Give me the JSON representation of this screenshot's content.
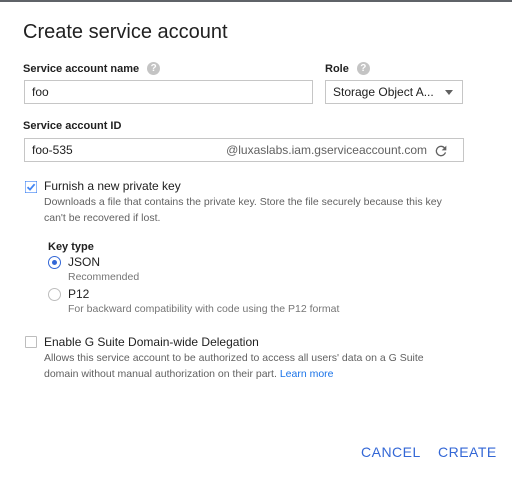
{
  "dialog": {
    "title": "Create service account"
  },
  "fields": {
    "name_label": "Service account name",
    "name_value": "foo",
    "role_label": "Role",
    "role_value": "Storage Object A...",
    "id_label": "Service account ID",
    "id_value": "foo-535",
    "id_suffix": "@luxaslabs.iam.gserviceaccount.com"
  },
  "private_key": {
    "checked": true,
    "label": "Furnish a new private key",
    "description_line1": "Downloads a file that contains the private key. Store the file securely because this key",
    "description_line2": "can't be recovered if lost.",
    "key_type_label": "Key type",
    "options": [
      {
        "label": "JSON",
        "sub": "Recommended",
        "selected": true
      },
      {
        "label": "P12",
        "sub": "For backward compatibility with code using the P12 format",
        "selected": false
      }
    ]
  },
  "delegation": {
    "checked": false,
    "label": "Enable G Suite Domain-wide Delegation",
    "description_line1": "Allows this service account to be authorized to access all users' data on a G Suite",
    "description_line2": "domain without manual authorization on their part.",
    "learn_more": "Learn more"
  },
  "actions": {
    "cancel": "CANCEL",
    "create": "CREATE"
  },
  "colors": {
    "accent": "#3367d6",
    "checkbox_checked": "#4285f4",
    "help_icon": "#c4c4c4"
  },
  "icons": [
    "help-icon",
    "chevron-down-icon",
    "refresh-icon",
    "checkmark-icon"
  ]
}
